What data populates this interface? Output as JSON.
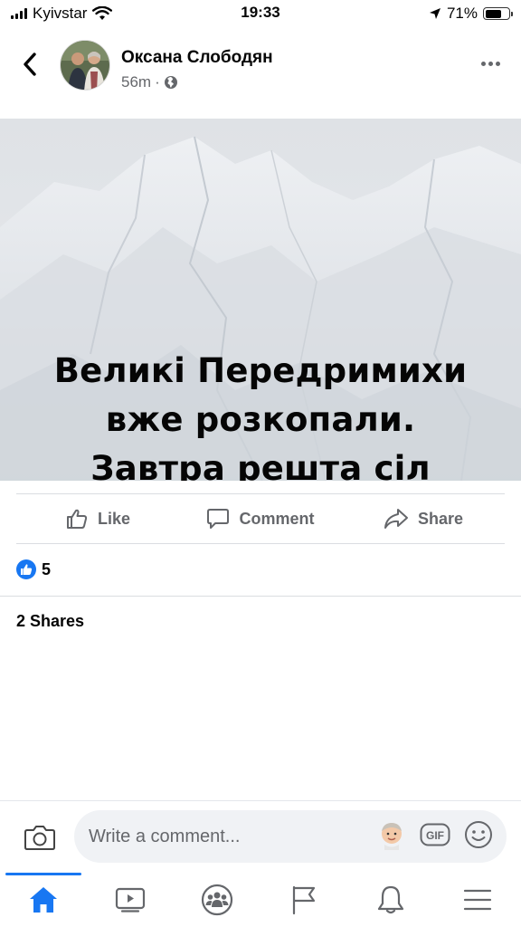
{
  "status_bar": {
    "carrier": "Kyivstar",
    "time": "19:33",
    "battery": "71%",
    "battery_level": 0.71
  },
  "post": {
    "author": "Оксана Слободян",
    "time_ago": "56m",
    "separator": "·",
    "privacy_icon": "globe-icon",
    "image_text": "Великі Передримихи\nвже розкопали.\nЗавтра решта сіл",
    "actions": {
      "like": "Like",
      "comment": "Comment",
      "share": "Share"
    },
    "reaction_count": "5",
    "shares": "2 Shares"
  },
  "comment_bar": {
    "placeholder": "Write a comment...",
    "gif_label": "GIF"
  },
  "tab_bar": {
    "tabs": [
      "home-icon",
      "watch-icon",
      "groups-icon",
      "pages-flag-icon",
      "notifications-bell-icon",
      "menu-icon"
    ],
    "active": "home-icon"
  },
  "colors": {
    "accent": "#1877f2",
    "secondary_text": "#65676b",
    "divider": "#dadde1"
  }
}
